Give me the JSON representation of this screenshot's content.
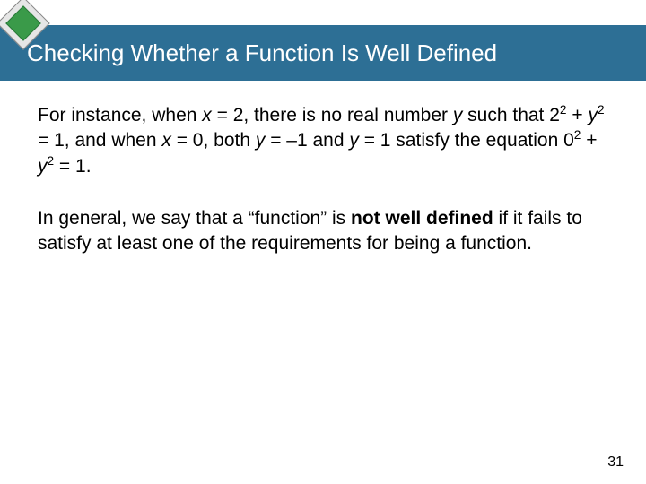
{
  "header": {
    "title": "Checking Whether a Function Is Well Defined"
  },
  "body": {
    "p1_a": "For instance, when ",
    "p1_x": "x",
    "p1_b": " = 2, there is no real number ",
    "p1_y1": "y",
    "p1_c": " such that  2",
    "p1_exp1": "2",
    "p1_d": " + ",
    "p1_y2": "y",
    "p1_exp2": "2",
    "p1_e": " = 1, and when ",
    "p1_x2": "x",
    "p1_f": " = 0, both ",
    "p1_y3": "y",
    "p1_g": " = –1 and ",
    "p1_y4": "y",
    "p1_h": " = 1 satisfy the equation 0",
    "p1_exp3": "2",
    "p1_i": " + ",
    "p1_y5": "y",
    "p1_exp4": "2",
    "p1_j": " = 1.",
    "p2_a": "In general, we say that a “function” is ",
    "p2_bold": "not well defined",
    "p2_b": " if it fails to satisfy at least one of the requirements for being a function."
  },
  "page_number": "31"
}
